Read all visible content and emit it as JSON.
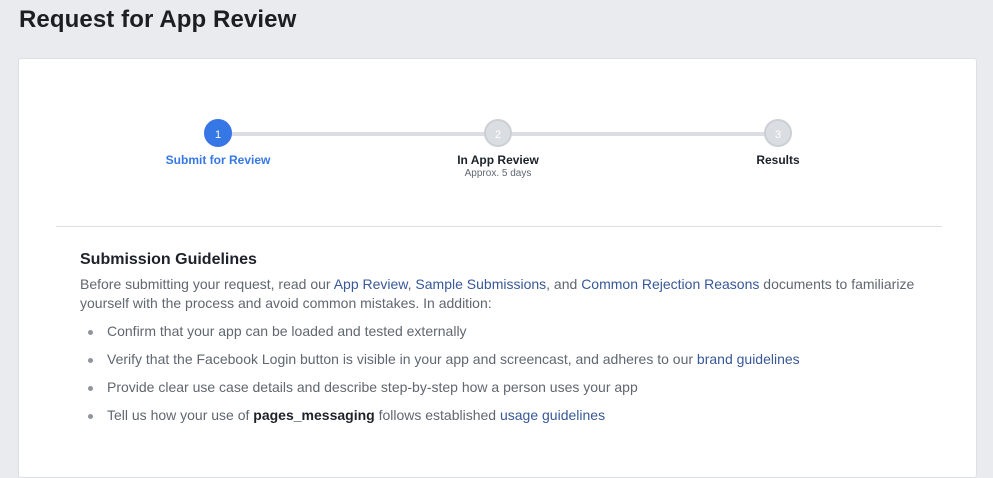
{
  "page": {
    "title": "Request for App Review"
  },
  "stepper": {
    "steps": [
      {
        "number": "1",
        "label": "Submit for Review",
        "sub": "",
        "state": "active"
      },
      {
        "number": "2",
        "label": "In App Review",
        "sub": "Approx. 5 days",
        "state": "inactive"
      },
      {
        "number": "3",
        "label": "Results",
        "sub": "",
        "state": "inactive"
      }
    ]
  },
  "guidelines": {
    "heading": "Submission Guidelines",
    "intro": {
      "before": "Before submitting your request, read our ",
      "link_app_review": "App Review",
      "sep1": ", ",
      "link_sample_submissions": "Sample Submissions",
      "sep2": ", and ",
      "link_common_rejection": "Common Rejection Reasons",
      "after": " documents to familiarize yourself with the process and avoid common mistakes. In addition:"
    },
    "items": [
      {
        "text": "Confirm that your app can be loaded and tested externally"
      },
      {
        "text": "Verify that the Facebook Login button is visible in your app and screencast, and adheres to our ",
        "link": "brand guidelines"
      },
      {
        "text": "Provide clear use case details and describe step-by-step how a person uses your app"
      },
      {
        "text_before": "Tell us how your use of ",
        "bold": "pages_messaging",
        "text_after": " follows established ",
        "link": "usage guidelines"
      }
    ]
  },
  "colors": {
    "background": "#e9ebee",
    "card": "#ffffff",
    "accent_active": "#3578e5",
    "link": "#385898",
    "inactive_step": "#dadde1"
  }
}
